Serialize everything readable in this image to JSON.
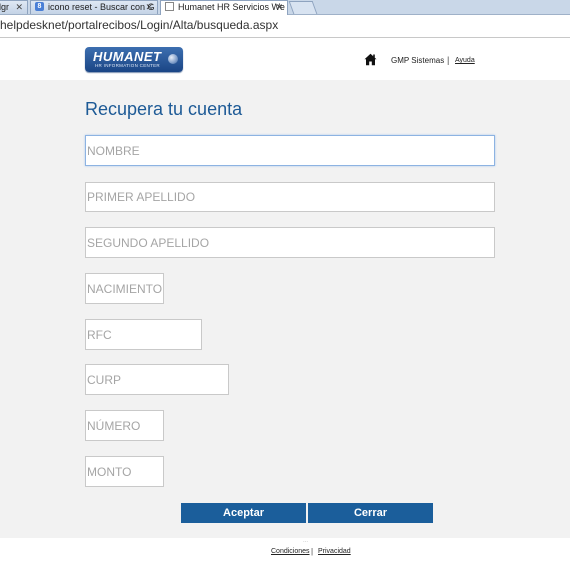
{
  "browser": {
    "tabs": [
      {
        "title": "lgr",
        "close": "✕"
      },
      {
        "title": "icono reset - Buscar con G",
        "close": "✕"
      },
      {
        "title": "Humanet HR Servicios We",
        "close": "✕"
      }
    ],
    "url": "helpdesknet/portalrecibos/Login/Alta/busqueda.aspx"
  },
  "header": {
    "logo_text": "HUMANET",
    "logo_subtext": "HR INFORMATION CENTER",
    "company": "GMP Sistemas",
    "separator": "|",
    "help_link": "Ayuda"
  },
  "form": {
    "title": "Recupera tu cuenta",
    "fields": [
      {
        "placeholder": "NOMBRE"
      },
      {
        "placeholder": "PRIMER APELLIDO"
      },
      {
        "placeholder": "SEGUNDO APELLIDO"
      },
      {
        "placeholder": "NACIMIENTO"
      },
      {
        "placeholder": "RFC"
      },
      {
        "placeholder": "CURP"
      },
      {
        "placeholder": "NÚMERO"
      },
      {
        "placeholder": "MONTO"
      }
    ],
    "accept_label": "Aceptar",
    "close_label": "Cerrar"
  },
  "footer": {
    "dots": "...",
    "conditions": "Condiciones",
    "separator": "|",
    "privacy": "Privacidad"
  }
}
